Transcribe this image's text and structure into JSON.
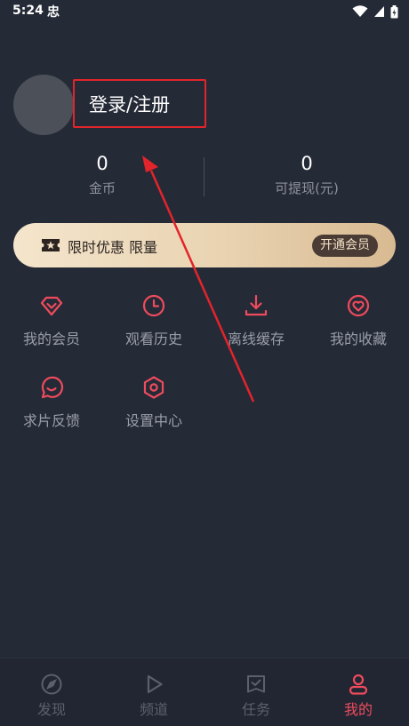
{
  "status_bar": {
    "time": "5:24",
    "app_indicator": "忠",
    "icons": [
      "wifi-icon",
      "signal-icon",
      "battery-icon"
    ]
  },
  "profile": {
    "login_label": "登录/注册"
  },
  "stats": {
    "coins": {
      "value": "0",
      "label": "金币"
    },
    "withdrawable": {
      "value": "0",
      "label": "可提现(元)"
    }
  },
  "vip_banner": {
    "text": "限时优惠 限量",
    "button_label": "开通会员",
    "icon": "ticket-star-icon"
  },
  "grid": [
    {
      "label": "我的会员",
      "icon": "diamond-icon"
    },
    {
      "label": "观看历史",
      "icon": "clock-icon"
    },
    {
      "label": "离线缓存",
      "icon": "download-icon"
    },
    {
      "label": "我的收藏",
      "icon": "heart-icon"
    },
    {
      "label": "求片反馈",
      "icon": "chat-bubble-icon"
    },
    {
      "label": "设置中心",
      "icon": "settings-hexagon-icon"
    }
  ],
  "bottom_nav": [
    {
      "label": "发现",
      "icon": "compass-icon",
      "active": false
    },
    {
      "label": "频道",
      "icon": "play-icon",
      "active": false
    },
    {
      "label": "任务",
      "icon": "task-checklist-icon",
      "active": false
    },
    {
      "label": "我的",
      "icon": "user-icon",
      "active": true
    }
  ],
  "colors": {
    "background": "#252a37",
    "accent": "#ef4b5c",
    "annotation_red": "#e3242b",
    "vip_gold": "#e9d3b1"
  }
}
